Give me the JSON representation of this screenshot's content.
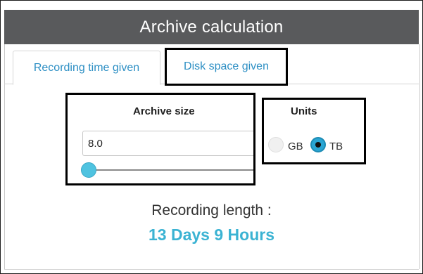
{
  "window": {
    "title": "Archive calculation"
  },
  "tabs": [
    {
      "label": "Recording time given",
      "active": false
    },
    {
      "label": "Disk space given",
      "active": true
    }
  ],
  "archive": {
    "label": "Archive size",
    "value": "8.0",
    "slider_fraction": 0.0
  },
  "units": {
    "label": "Units",
    "options": [
      {
        "label": "GB",
        "selected": false
      },
      {
        "label": "TB",
        "selected": true
      }
    ]
  },
  "result": {
    "label": "Recording length :",
    "value": "13 Days 9 Hours"
  },
  "colors": {
    "title_bar": "#595a5c",
    "accent": "#3bb3d3",
    "tab_text": "#2d8fc4"
  }
}
